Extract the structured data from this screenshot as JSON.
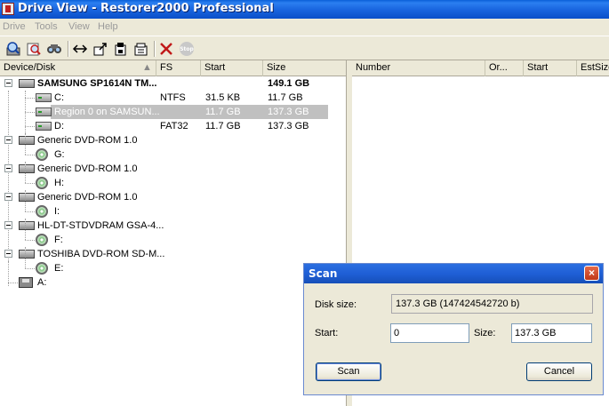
{
  "window": {
    "title": "Drive View - Restorer2000 Professional"
  },
  "menu": [
    "Drive",
    "Tools",
    "View",
    "Help"
  ],
  "toolbar": {
    "icons": [
      "scan-disk-icon",
      "search-icon",
      "find-icon",
      "swap-icon",
      "export-icon",
      "save-icon",
      "open-icon",
      "delete-icon",
      "stop-icon"
    ],
    "stop_label": "Stop"
  },
  "left_columns": [
    "Device/Disk",
    "FS",
    "Start",
    "Size"
  ],
  "right_columns": [
    "Number",
    "Or...",
    "Start",
    "EstSize"
  ],
  "tree": [
    {
      "name": "SAMSUNG SP1614N TM...",
      "fs": "",
      "start": "",
      "size": "149.1 GB"
    },
    {
      "name": "C:",
      "fs": "NTFS",
      "start": "31.5 KB",
      "size": "11.7 GB"
    },
    {
      "name": "Region 0 on SAMSUN...",
      "fs": "",
      "start": "11.7 GB",
      "size": "137.3 GB"
    },
    {
      "name": "D:",
      "fs": "FAT32",
      "start": "11.7 GB",
      "size": "137.3 GB"
    },
    {
      "name": "Generic DVD-ROM 1.0"
    },
    {
      "name": "G:"
    },
    {
      "name": "Generic DVD-ROM 1.0"
    },
    {
      "name": "H:"
    },
    {
      "name": "Generic DVD-ROM 1.0"
    },
    {
      "name": "I:"
    },
    {
      "name": "HL-DT-STDVDRAM GSA-4..."
    },
    {
      "name": "F:"
    },
    {
      "name": "TOSHIBA DVD-ROM SD-M..."
    },
    {
      "name": "E:"
    },
    {
      "name": "A:"
    }
  ],
  "scan_dialog": {
    "title": "Scan",
    "close": "×",
    "disk_size_label": "Disk size:",
    "disk_size_value": "137.3 GB (147424542720 b)",
    "start_label": "Start:",
    "start_value": "0",
    "size_label": "Size:",
    "size_value": "137.3 GB",
    "scan_button": "Scan",
    "cancel_button": "Cancel"
  },
  "colors": {
    "titlebar": "#0a5fd8",
    "selection": "#c0c0c0",
    "chrome": "#ece9d8"
  }
}
